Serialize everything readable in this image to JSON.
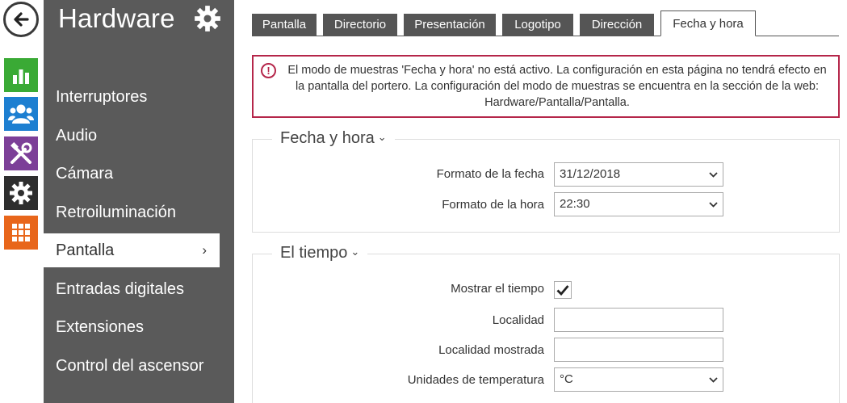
{
  "sidebar": {
    "title": "Hardware",
    "items": [
      {
        "label": "Interruptores"
      },
      {
        "label": "Audio"
      },
      {
        "label": "Cámara"
      },
      {
        "label": "Retroiluminación"
      },
      {
        "label": "Pantalla",
        "active": true
      },
      {
        "label": "Entradas digitales"
      },
      {
        "label": "Extensiones"
      },
      {
        "label": "Control del ascensor"
      }
    ],
    "active_chevron": "›"
  },
  "tabs": [
    {
      "label": "Pantalla"
    },
    {
      "label": "Directorio"
    },
    {
      "label": "Presentación"
    },
    {
      "label": "Logotipo"
    },
    {
      "label": "Dirección"
    },
    {
      "label": "Fecha y hora",
      "active": true
    }
  ],
  "warning": {
    "icon": "!",
    "text": "El modo de muestras 'Fecha y hora' no está activo. La configuración en esta página no tendrá efecto en la pantalla del portero. La configuración del modo de muestras se encuentra en la sección de la web: Hardware/Pantalla/Pantalla."
  },
  "datetime_section": {
    "title": "Fecha y hora",
    "date_format_label": "Formato de la fecha",
    "date_format_value": "31/12/2018",
    "time_format_label": "Formato de la hora",
    "time_format_value": "22:30"
  },
  "weather_section": {
    "title": "El tiempo",
    "show_weather_label": "Mostrar el tiempo",
    "show_weather_checked": true,
    "locality_label": "Localidad",
    "locality_value": "",
    "shown_locality_label": "Localidad mostrada",
    "shown_locality_value": "",
    "temp_units_label": "Unidades de temperatura",
    "temp_units_value": "°C"
  },
  "colors": {
    "sidebar_bg": "#5a5a5a",
    "tab_bg": "#555555",
    "warning_border": "#b5264a",
    "status_icon": "#3aaa35",
    "directory_icon": "#1d7fd1",
    "hardware_icon": "#7c3f98",
    "services_icon": "#2e2e2e",
    "system_icon": "#e8661b"
  }
}
